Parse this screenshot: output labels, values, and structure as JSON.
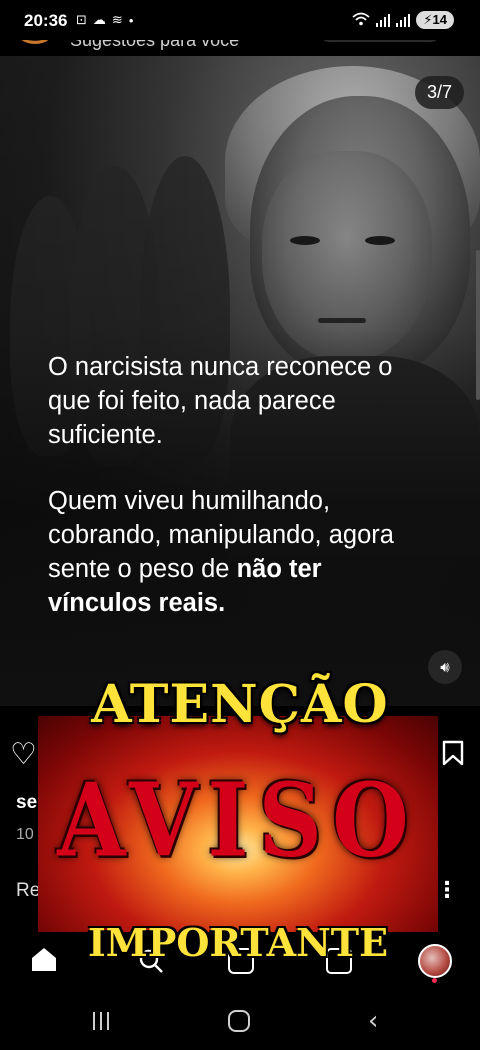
{
  "status_bar": {
    "time": "20:36",
    "battery": "14",
    "left_icons": [
      "screen-record-icon",
      "cloud-icon",
      "nfc-icon",
      "dot-icon"
    ],
    "right_icons": [
      "wifi-icon",
      "signal-icon",
      "signal-icon",
      "battery-charging-icon"
    ]
  },
  "header": {
    "title": "Sugestões para você"
  },
  "post": {
    "page_counter": "3/7",
    "paragraph1": "O narcisista nunca reconece o que foi feito, nada parece suficiente.",
    "paragraph2_lines": [
      "Quem viveu humilhando,",
      "cobrando, manipulando, agora",
      "sente o peso de "
    ],
    "paragraph2_bold_1": "não ter",
    "paragraph2_bold_2": "vínculos reais.",
    "sound_icon": "speaker-icon"
  },
  "post_meta": {
    "username_partial": "se",
    "count_partial": "10",
    "reply_partial": "Re"
  },
  "sticker": {
    "line1": "ATENÇÃO",
    "line2": "AVISO",
    "line3": "IMPORTANTE"
  },
  "nav": {
    "icons": [
      "home-icon",
      "search-icon",
      "reels-icon",
      "shop-icon",
      "profile-avatar"
    ]
  },
  "system_nav": {
    "icons": [
      "recents-icon",
      "home-button-icon",
      "back-icon"
    ]
  },
  "colors": {
    "sticker_yellow": "#ffe23a",
    "sticker_red": "#d4001a",
    "notification": "#ff2d55"
  }
}
